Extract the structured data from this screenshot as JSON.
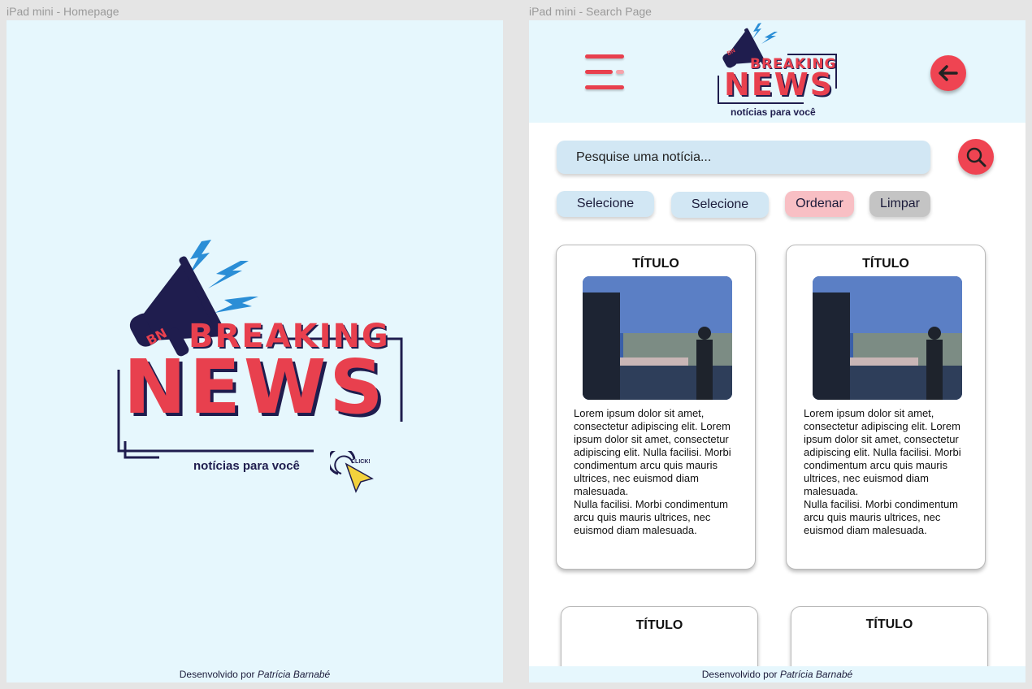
{
  "frames": {
    "home_label": "iPad mini - Homepage",
    "search_label": "iPad mini - Search Page"
  },
  "logo": {
    "breaking": "BREAKING",
    "news": "NEWS",
    "badge": "BN",
    "tagline": "notícias para você",
    "click": "CLICK!"
  },
  "footer": {
    "prefix": "Desenvolvido por ",
    "author": "Patrícia Barnabé"
  },
  "search": {
    "placeholder": "Pesquise uma notícia..."
  },
  "filters": [
    {
      "label": "Selecione",
      "color": "#d2e7f4"
    },
    {
      "label": "Selecione",
      "color": "#d2e7f4"
    },
    {
      "label": "Ordenar",
      "color": "#f8bfc4"
    },
    {
      "label": "Limpar",
      "color": "#c4c4c4"
    }
  ],
  "cards": [
    {
      "title": "TÍTULO",
      "text": "Lorem ipsum dolor sit amet, consectetur adipiscing elit. Lorem ipsum dolor sit amet, consectetur adipiscing elit. Nulla facilisi. Morbi condimentum arcu quis mauris ultrices, nec euismod diam malesuada.\nNulla facilisi. Morbi condimentum arcu quis mauris ultrices, nec euismod diam malesuada."
    },
    {
      "title": "TÍTULO",
      "text": "Lorem ipsum dolor sit amet, consectetur adipiscing elit. Lorem ipsum dolor sit amet, consectetur adipiscing elit. Nulla facilisi. Morbi condimentum arcu quis mauris ultrices, nec euismod diam malesuada.\nNulla facilisi. Morbi condimentum arcu quis mauris ultrices, nec euismod diam malesuada."
    },
    {
      "title": "TÍTULO"
    },
    {
      "title": "TÍTULO"
    }
  ],
  "colors": {
    "brand_red": "#e8404e",
    "brand_navy": "#1f1d4e",
    "bolt_blue": "#2b8ed6",
    "background": "#e6f7fd"
  }
}
